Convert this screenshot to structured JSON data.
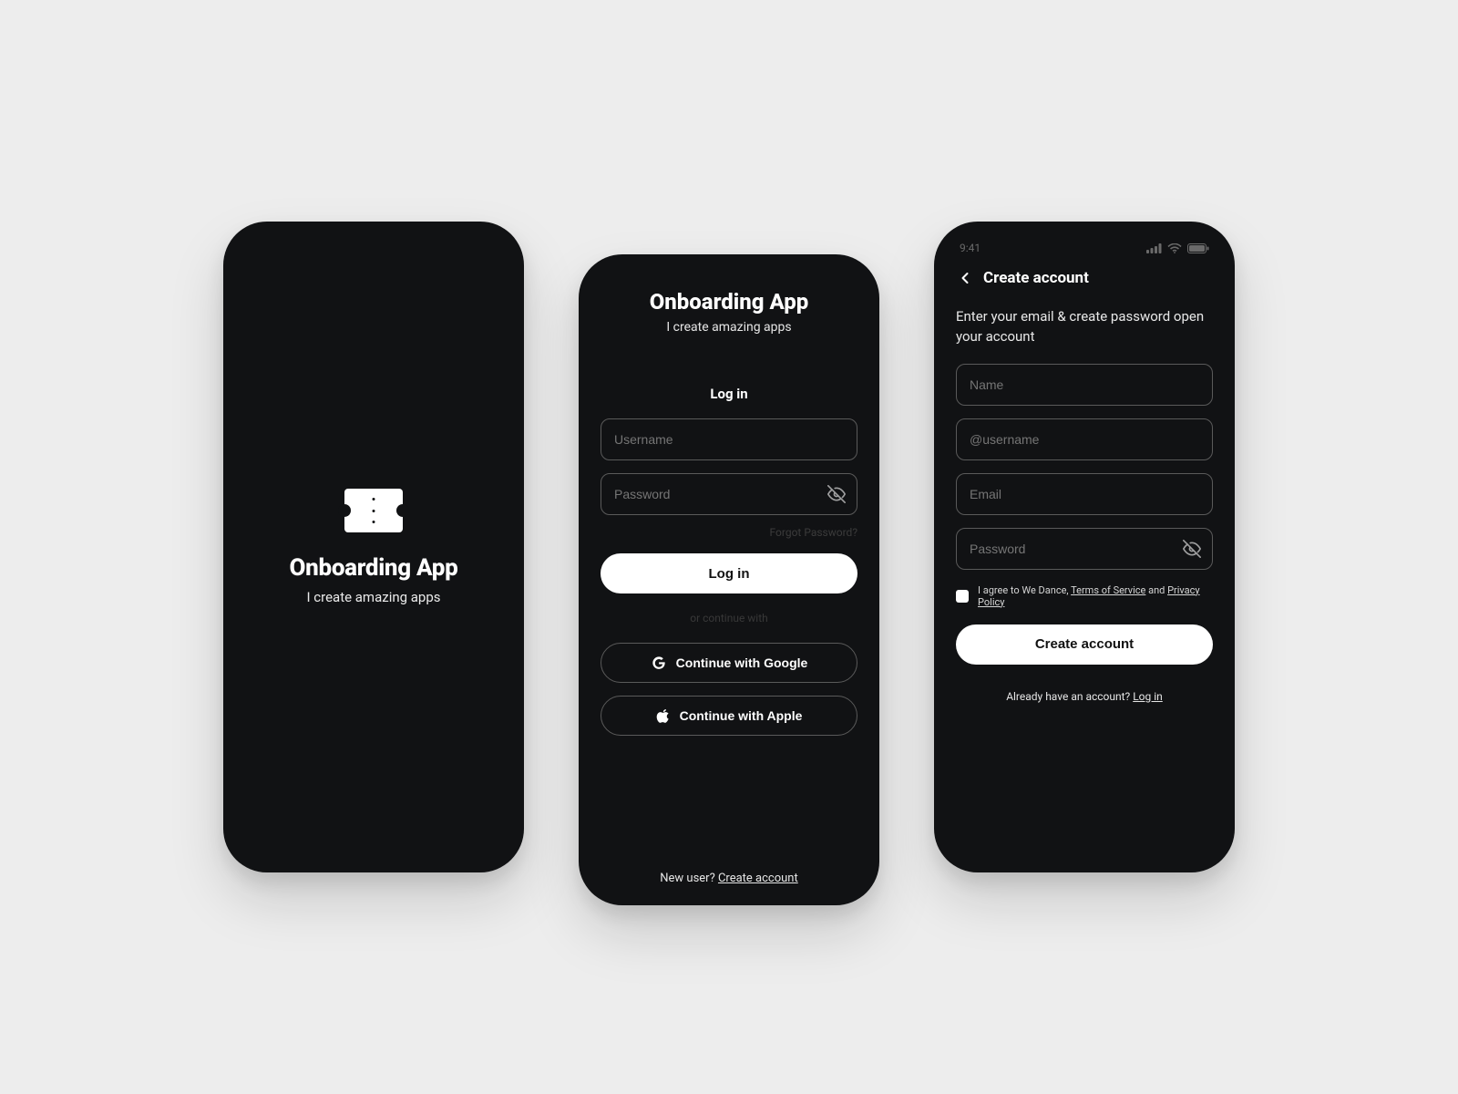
{
  "splash": {
    "title": "Onboarding App",
    "subtitle": "I create amazing apps"
  },
  "login": {
    "title": "Onboarding App",
    "subtitle": "I create amazing apps",
    "section_label": "Log in",
    "username_placeholder": "Username",
    "password_placeholder": "Password",
    "forgot_label": "Forgot Password?",
    "login_button": "Log in",
    "continue_divider": "or continue with",
    "google_label": "Continue with Google",
    "apple_label": "Continue with Apple",
    "footer_prompt": "New user? ",
    "footer_link": "Create account"
  },
  "create": {
    "status_time": "9:41",
    "header": "Create account",
    "description": "Enter your email & create password open your account",
    "name_placeholder": "Name",
    "username_placeholder": "@username",
    "email_placeholder": "Email",
    "password_placeholder": "Password",
    "agree_prefix": "I agree to We Dance, ",
    "terms_label": "Terms of Service",
    "agree_mid": " and ",
    "privacy_label": "Privacy Policy",
    "submit_label": "Create account",
    "already_prompt": "Already have an account? ",
    "already_link": "Log in"
  }
}
